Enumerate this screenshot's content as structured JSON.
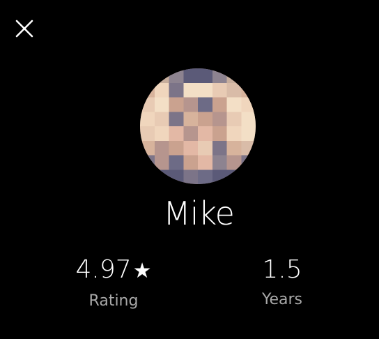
{
  "close": {
    "icon": "close-icon"
  },
  "profile": {
    "name": "Mike",
    "avatar": "avatar-image-pixelated"
  },
  "stats": {
    "rating": {
      "value": "4.97",
      "star": "★",
      "label": "Rating"
    },
    "years": {
      "value": "1.5",
      "label": "Years"
    }
  },
  "colors": {
    "background": "#000000",
    "text_primary": "#ffffff",
    "text_secondary": "#a8a8a8"
  }
}
